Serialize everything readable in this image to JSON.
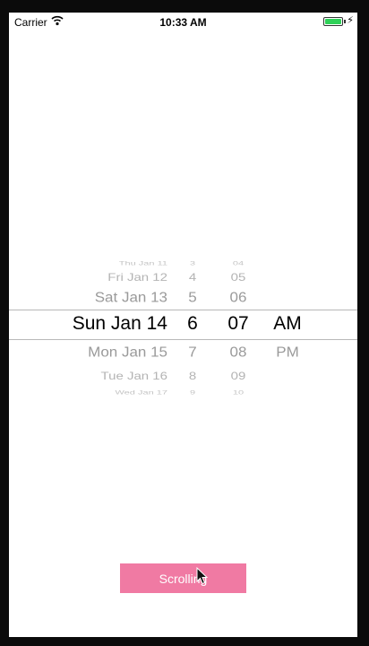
{
  "status_bar": {
    "carrier": "Carrier",
    "time": "10:33 AM",
    "battery_color": "#2fd158"
  },
  "picker": {
    "dates": [
      "Thu Jan 11",
      "Fri Jan 12",
      "Sat Jan 13",
      "Sun Jan 14",
      "Mon Jan 15",
      "Tue Jan 16",
      "Wed Jan 17"
    ],
    "hours": [
      "3",
      "4",
      "5",
      "6",
      "7",
      "8",
      "9"
    ],
    "minutes": [
      "04",
      "05",
      "06",
      "07",
      "08",
      "09",
      "10"
    ],
    "periods": [
      "AM",
      "PM"
    ],
    "selected": {
      "date": "Sun Jan 14",
      "hour": "6",
      "minute": "07",
      "period": "AM"
    }
  },
  "action_button": {
    "label": "Scrolling",
    "color": "#f07aa3"
  }
}
